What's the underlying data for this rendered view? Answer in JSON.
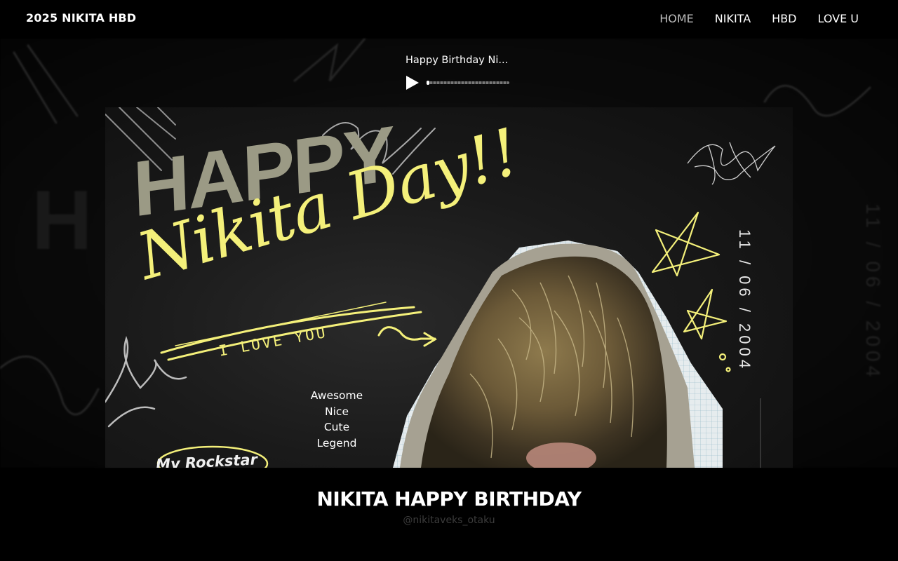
{
  "header": {
    "brand": "2025 NIKITA HBD",
    "nav": [
      {
        "label": "HOME",
        "active": true
      },
      {
        "label": "NIKITA",
        "active": false
      },
      {
        "label": "HBD",
        "active": false
      },
      {
        "label": "LOVE U",
        "active": false
      }
    ]
  },
  "player": {
    "title": "Happy Birthday Ni...",
    "state": "paused",
    "play_icon": "play-icon",
    "progress": 0.02
  },
  "poster": {
    "happy": "HAPPY",
    "headline": "Nikita Day!!",
    "love_you": "I LOVE YOU",
    "words": [
      "Awesome",
      "Nice",
      "Cute",
      "Legend"
    ],
    "date": "11 / 06 / 2004",
    "rockstar": "My Rockstar",
    "accent_color": "#f4f07a"
  },
  "caption": {
    "title": "NIKITA HAPPY BIRTHDAY",
    "handle": "@nikitaveks_otaku"
  }
}
